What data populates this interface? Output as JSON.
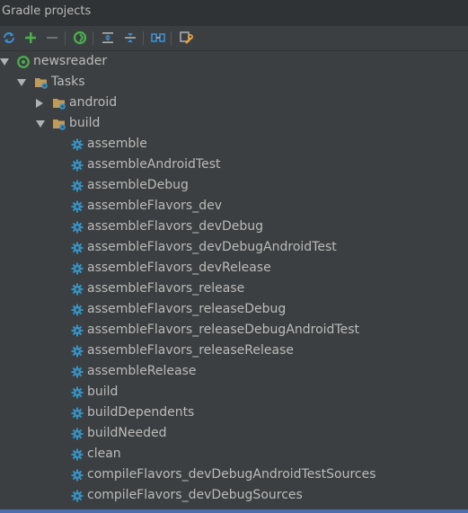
{
  "panel": {
    "title": "Gradle projects"
  },
  "toolbar": {
    "buttons": [
      "refresh-icon",
      "add-icon",
      "remove-icon",
      "gradle-sync-icon",
      "expand-all-icon",
      "collapse-all-icon",
      "link-icon",
      "settings-wrench-icon"
    ]
  },
  "tree": {
    "project": "newsreader",
    "tasks_folder": "Tasks",
    "groups": [
      {
        "label": "android",
        "expanded": false
      },
      {
        "label": "build",
        "expanded": true
      }
    ],
    "build_tasks": [
      "assemble",
      "assembleAndroidTest",
      "assembleDebug",
      "assembleFlavors_dev",
      "assembleFlavors_devDebug",
      "assembleFlavors_devDebugAndroidTest",
      "assembleFlavors_devRelease",
      "assembleFlavors_release",
      "assembleFlavors_releaseDebug",
      "assembleFlavors_releaseDebugAndroidTest",
      "assembleFlavors_releaseRelease",
      "assembleRelease",
      "build",
      "buildDependents",
      "buildNeeded",
      "clean",
      "compileFlavors_devDebugAndroidTestSources",
      "compileFlavors_devDebugSources"
    ]
  },
  "colors": {
    "background": "#3c3f41",
    "text": "#bbbbbb",
    "gear": "#3592c4",
    "gradle_green": "#4caf50",
    "selection": "#4b6eaf"
  }
}
